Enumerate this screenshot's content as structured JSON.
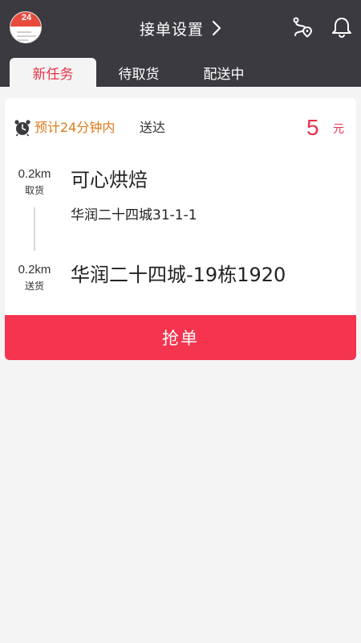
{
  "header": {
    "avatar_badge": "24",
    "title": "接单设置",
    "icons": [
      "chevron-right-icon",
      "route-pin-icon",
      "bell-icon"
    ]
  },
  "tabs": [
    {
      "label": "新任务",
      "active": true
    },
    {
      "label": "待取货",
      "active": false
    },
    {
      "label": "配送中",
      "active": false
    }
  ],
  "order": {
    "eta": "预计24分钟内",
    "eta_suffix": "送达",
    "price": "5",
    "price_unit": "元",
    "pickup": {
      "distance": "0.2km",
      "label": "取货",
      "shop": "可心烘焙",
      "address": "华润二十四城31-1-1"
    },
    "dropoff": {
      "distance": "0.2km",
      "label": "送货",
      "address": "华润二十四城-19栋1920"
    },
    "grab_label": "抢单"
  },
  "colors": {
    "header_bg": "#3b3a40",
    "accent": "#e8334a",
    "button": "#f5344f",
    "eta": "#e07a1a",
    "page_bg": "#f4f4f4"
  }
}
